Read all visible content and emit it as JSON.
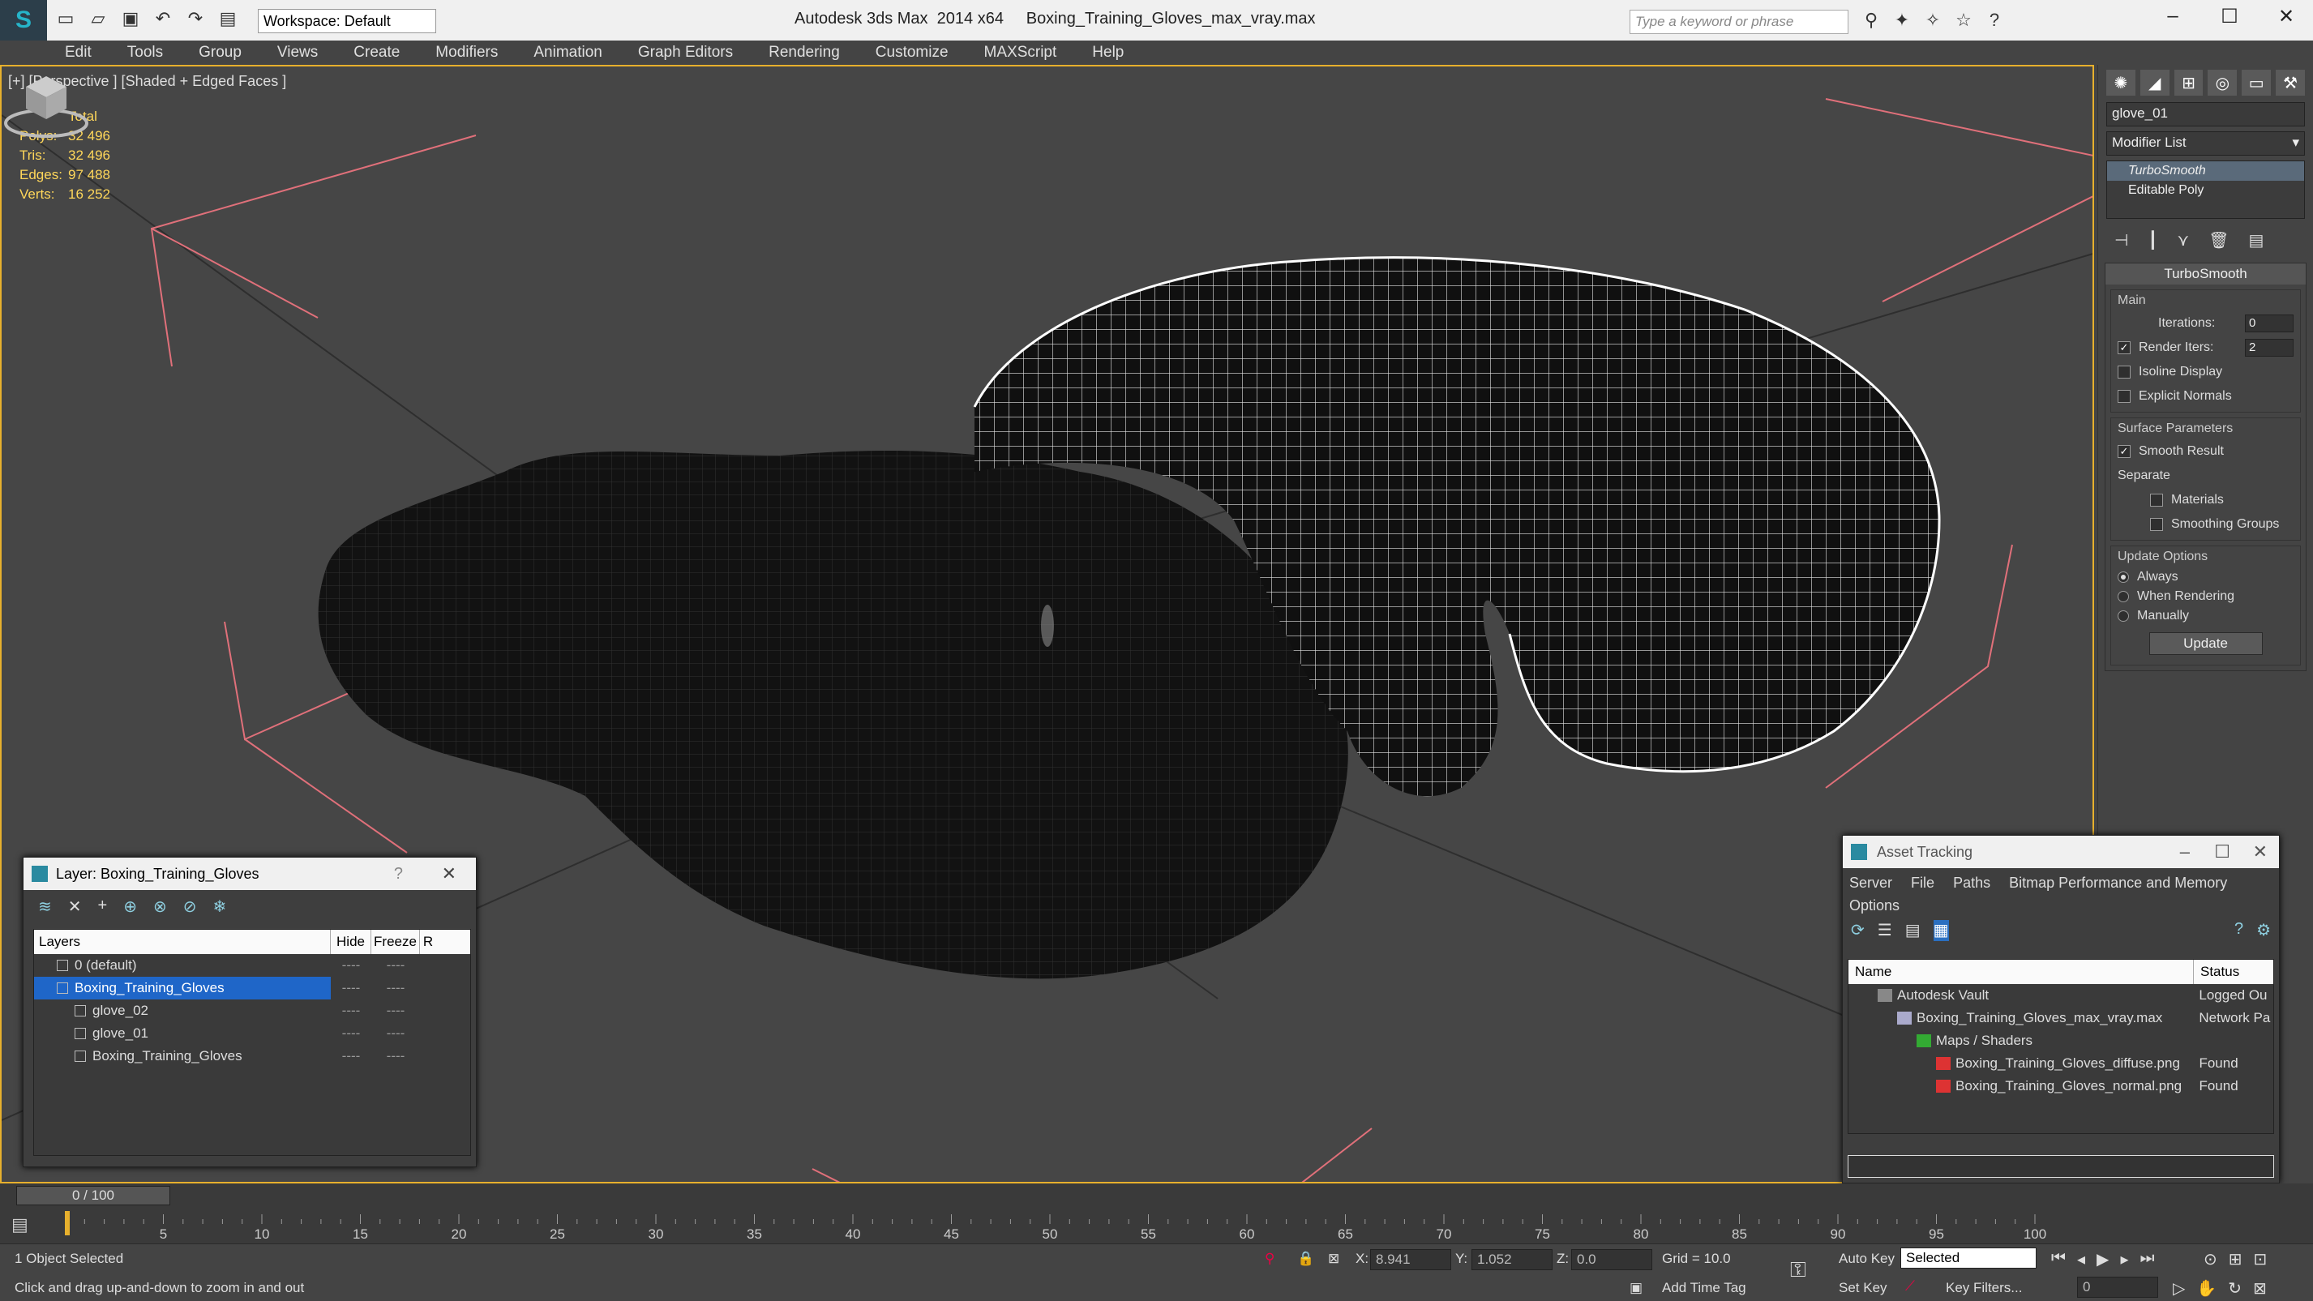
{
  "app": {
    "title": "Autodesk 3ds Max  2014 x64     Boxing_Training_Gloves_max_vray.max",
    "workspace": "Workspace: Default",
    "search_placeholder": "Type a keyword or phrase"
  },
  "menu": [
    "Edit",
    "Tools",
    "Group",
    "Views",
    "Create",
    "Modifiers",
    "Animation",
    "Graph Editors",
    "Rendering",
    "Customize",
    "MAXScript",
    "Help"
  ],
  "viewport": {
    "label": "[+] [Perspective ] [Shaded + Edged Faces ]",
    "stats": {
      "header": "Total",
      "polys_label": "Polys:",
      "polys": "32 496",
      "tris_label": "Tris:",
      "tris": "32 496",
      "edges_label": "Edges:",
      "edges": "97 488",
      "verts_label": "Verts:",
      "verts": "16 252"
    }
  },
  "command_panel": {
    "object_name": "glove_01",
    "modifier_list": "Modifier List",
    "stack": [
      "TurboSmooth",
      "Editable Poly"
    ],
    "rollout_title": "TurboSmooth",
    "main_group": "Main",
    "iterations_label": "Iterations:",
    "iterations": "0",
    "render_iters_label": "Render Iters:",
    "render_iters": "2",
    "isoline_display": "Isoline Display",
    "explicit_normals": "Explicit Normals",
    "surface_group": "Surface Parameters",
    "smooth_result": "Smooth Result",
    "separate": "Separate",
    "materials": "Materials",
    "smoothing_groups": "Smoothing Groups",
    "update_group": "Update Options",
    "always": "Always",
    "when_rendering": "When Rendering",
    "manually": "Manually",
    "update_button": "Update"
  },
  "layer_window": {
    "title": "Layer: Boxing_Training_Gloves",
    "help": "?",
    "col_layers": "Layers",
    "col_hide": "Hide",
    "col_freeze": "Freeze",
    "col_render": "R",
    "rows": [
      {
        "name": "0 (default)"
      },
      {
        "name": "Boxing_Training_Gloves"
      },
      {
        "name": "glove_02"
      },
      {
        "name": "glove_01"
      },
      {
        "name": "Boxing_Training_Gloves"
      }
    ],
    "dashes": "----"
  },
  "asset_window": {
    "title": "Asset Tracking",
    "menu": [
      "Server",
      "File",
      "Paths",
      "Bitmap Performance and Memory",
      "Options"
    ],
    "col_name": "Name",
    "col_status": "Status",
    "rows": [
      {
        "name": "Autodesk Vault",
        "status": "Logged Ou"
      },
      {
        "name": "Boxing_Training_Gloves_max_vray.max",
        "status": "Network Pa"
      },
      {
        "name": "Maps / Shaders",
        "status": ""
      },
      {
        "name": "Boxing_Training_Gloves_diffuse.png",
        "status": "Found"
      },
      {
        "name": "Boxing_Training_Gloves_normal.png",
        "status": "Found"
      }
    ]
  },
  "timeline": {
    "frame": "0 / 100",
    "ticks": [
      "5",
      "10",
      "15",
      "20",
      "25",
      "30",
      "35",
      "40",
      "45",
      "50",
      "55",
      "60",
      "65",
      "70",
      "75",
      "80",
      "85",
      "90",
      "95",
      "100"
    ]
  },
  "status": {
    "selected": "1 Object Selected",
    "hint": "Click and drag up-and-down to zoom in and out",
    "x_label": "X:",
    "x": "8.941",
    "y_label": "Y:",
    "y": "1.052",
    "z_label": "Z:",
    "z": "0.0",
    "grid": "Grid = 10.0",
    "add_time_tag": "Add Time Tag",
    "auto_key": "Auto Key",
    "set_key": "Set Key",
    "selected_dropdown": "Selected",
    "key_filters": "Key Filters...",
    "frame_field": "0"
  }
}
